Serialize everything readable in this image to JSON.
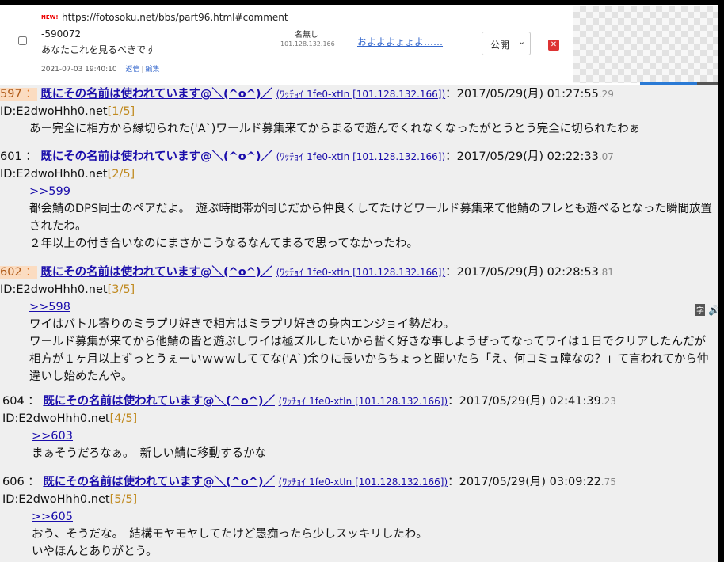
{
  "top_comment": {
    "badge": "NEW!",
    "url_line1": "https://fotosoku.net/bbs/part96.html#comment",
    "url_line2": "-590072",
    "text": "あなたこれを見るべきです",
    "datetime": "2021-07-03 19:40:10",
    "reply": "返信",
    "edit": "編集",
    "name": "名無し",
    "ip": "101.128.132.166",
    "page_title": "およよよょょよ……",
    "visibility": "公開",
    "visibility_chevron": "chevron-down-icon",
    "delete_icon": "close-icon"
  },
  "posts": [
    {
      "num": "597",
      "sep": "：",
      "name": "既にその名前は使われています@＼(^o^)／",
      "trip": "(ﾜｯﾁｮｲ 1fe0-xtIn [101.128.132.166])",
      "date": "：2017/05/29(月) 01:27:55",
      "ms": ".29",
      "id": "ID:E2dwoHhh0.net",
      "count": "[1/5]",
      "anchor": "",
      "lines": [
        "あー完全に相方から縁切られた('A`)ワールド募集来てからまるで遊んでくれなくなったがとうとう完全に切られたわぁ"
      ]
    },
    {
      "num": "601",
      "sep": "：",
      "name": "既にその名前は使われています@＼(^o^)／",
      "trip": "(ﾜｯﾁｮｲ 1fe0-xtIn [101.128.132.166])",
      "date": "：2017/05/29(月) 02:22:33",
      "ms": ".07",
      "id": "ID:E2dwoHhh0.net",
      "count": "[2/5]",
      "anchor": ">>599",
      "lines": [
        "都会鯖のDPS同士のペアだよ。　遊ぶ時間帯が同じだから仲良くしてたけどワールド募集来て他鯖のフレとも遊べるとなった瞬間放置されたわ。",
        "２年以上の付き合いなのにまさかこうなるなんてまるで思ってなかったわ。"
      ]
    },
    {
      "num": "602",
      "sep": "：",
      "name": "既にその名前は使われています@＼(^o^)／",
      "trip": "(ﾜｯﾁｮｲ 1fe0-xtIn [101.128.132.166])",
      "date": "：2017/05/29(月) 02:28:53",
      "ms": ".81",
      "id": "ID:E2dwoHhh0.net",
      "count": "[3/5]",
      "anchor": ">>598",
      "lines": [
        "ワイはバトル寄りのミラプリ好きで相方はミラプリ好きの身内エンジョイ勢だわ。",
        "ワールド募集が来てから他鯖の皆と遊ぶしワイは極ズルしたいから暫く好きな事しようぜってなってワイは１日でクリアしたんだが相方が１ヶ月以上ずっとうぇーいｗｗｗしててな('A`)余りに長いからちょっと聞いたら「え、何コミュ障なの？」て言われてから仲違いし始めたんや。"
      ]
    },
    {
      "num": "604",
      "sep": "：",
      "name": "既にその名前は使われています@＼(^o^)／",
      "trip": "(ﾜｯﾁｮｲ 1fe0-xtIn [101.128.132.166])",
      "date": "：2017/05/29(月) 02:41:39",
      "ms": ".23",
      "id": "ID:E2dwoHhh0.net",
      "count": "[4/5]",
      "anchor": ">>603",
      "lines": [
        "まぁそうだろなぁ。　新しい鯖に移動するかな"
      ]
    },
    {
      "num": "606",
      "sep": "：",
      "name": "既にその名前は使われています@＼(^o^)／",
      "trip": "(ﾜｯﾁｮｲ 1fe0-xtIn [101.128.132.166])",
      "date": "：2017/05/29(月) 03:09:22",
      "ms": ".75",
      "id": "ID:E2dwoHhh0.net",
      "count": "[5/5]",
      "anchor": ">>605",
      "lines": [
        "おう、そうだな。　結構モヤモヤしてたけど愚痴ったら少しスッキリしたわ。",
        "いやほんとありがとう。"
      ]
    }
  ],
  "side_icons": {
    "translate_label": "字",
    "translate_icon": "translate-icon",
    "speaker_glyph": "🔊",
    "speaker_icon": "speaker-icon"
  }
}
